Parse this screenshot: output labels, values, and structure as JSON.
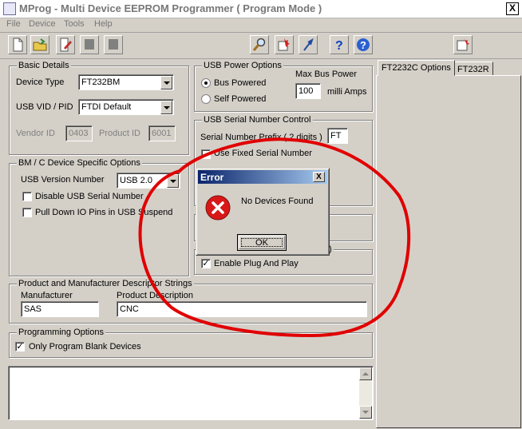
{
  "window": {
    "title": "MProg - Multi Device EEPROM Programmer ( Program Mode )",
    "close_glyph": "X"
  },
  "menu": [
    "File",
    "Device",
    "Tools",
    "Help"
  ],
  "toolbar": {
    "icons": [
      "new-file-icon",
      "open-folder-icon",
      "edit-icon",
      "stop-icon",
      "stop-icon",
      "search-icon",
      "device-icon",
      "flash-icon",
      "help-icon",
      "about-icon",
      "close-window-icon"
    ]
  },
  "basic_details": {
    "title": "Basic Details",
    "device_type_label": "Device Type",
    "device_type_value": "FT232BM",
    "vid_pid_label": "USB VID / PID",
    "vid_pid_value": "FTDI Default",
    "vendor_id_label": "Vendor ID",
    "vendor_id_value": "0403",
    "product_id_label": "Product ID",
    "product_id_value": "6001"
  },
  "usb_power": {
    "title": "USB Power Options",
    "bus_powered": "Bus Powered",
    "self_powered": "Self Powered",
    "selected": "Bus Powered",
    "max_bus_power_label": "Max Bus Power",
    "max_bus_power_value": "100",
    "unit": "milli Amps"
  },
  "serial_number": {
    "title": "USB Serial Number Control",
    "prefix_label": "Serial Number Prefix ( 2 digits )",
    "prefix_value": "FT",
    "use_fixed_label": "Use Fixed Serial Number"
  },
  "bm_options": {
    "title": "BM / C Device Specific Options",
    "usb_version_label": "USB Version Number",
    "usb_version_value": "USB 2.0",
    "disable_serial_label": "Disable USB Serial Number",
    "pull_down_label": "Pull Down IO Pins in USB Suspend"
  },
  "pnp": {
    "fragment": ")",
    "label": "Enable Plug And Play"
  },
  "strings": {
    "title": "Product and Manufacturer Descriptor Strings",
    "manufacturer_label": "Manufacturer",
    "manufacturer_value": "SAS",
    "product_label": "Product Description",
    "product_value": "CNC"
  },
  "programming": {
    "title": "Programming Options",
    "blank_only_label": "Only Program Blank Devices",
    "blank_only_checked": true
  },
  "tabs": [
    "FT2232C Options",
    "FT232R"
  ],
  "dialog": {
    "title": "Error",
    "message": "No Devices Found",
    "ok_label": "OK",
    "close_glyph": "X"
  },
  "annotation_color": "#e00000"
}
